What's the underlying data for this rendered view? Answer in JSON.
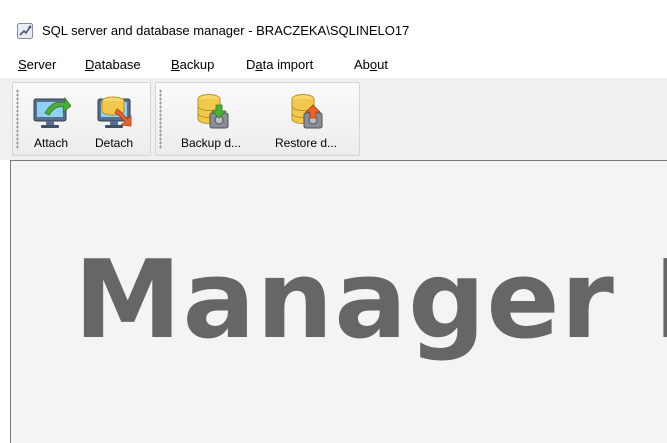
{
  "window": {
    "title": "SQL server and database manager - BRACZEKA\\SQLINELO17",
    "icon": "app-icon"
  },
  "menu": {
    "items": [
      {
        "key": "S",
        "rest": "erver"
      },
      {
        "key": "D",
        "rest": "atabase"
      },
      {
        "key": "B",
        "rest": "ackup"
      },
      {
        "pre": "D",
        "key": "a",
        "rest": "ta import"
      },
      {
        "pre": "Ab",
        "key": "o",
        "rest": "ut"
      }
    ]
  },
  "toolbar": {
    "attach_label": "Attach",
    "detach_label": "Detach",
    "backup_label": "Backup d...",
    "restore_label": "Restore d..."
  },
  "content": {
    "splash_text": "Manager D"
  },
  "colors": {
    "splash_text": "#666666",
    "db_yellow": "#f2c94c",
    "arrow_green": "#4caf3a",
    "arrow_orange": "#e8642c"
  }
}
